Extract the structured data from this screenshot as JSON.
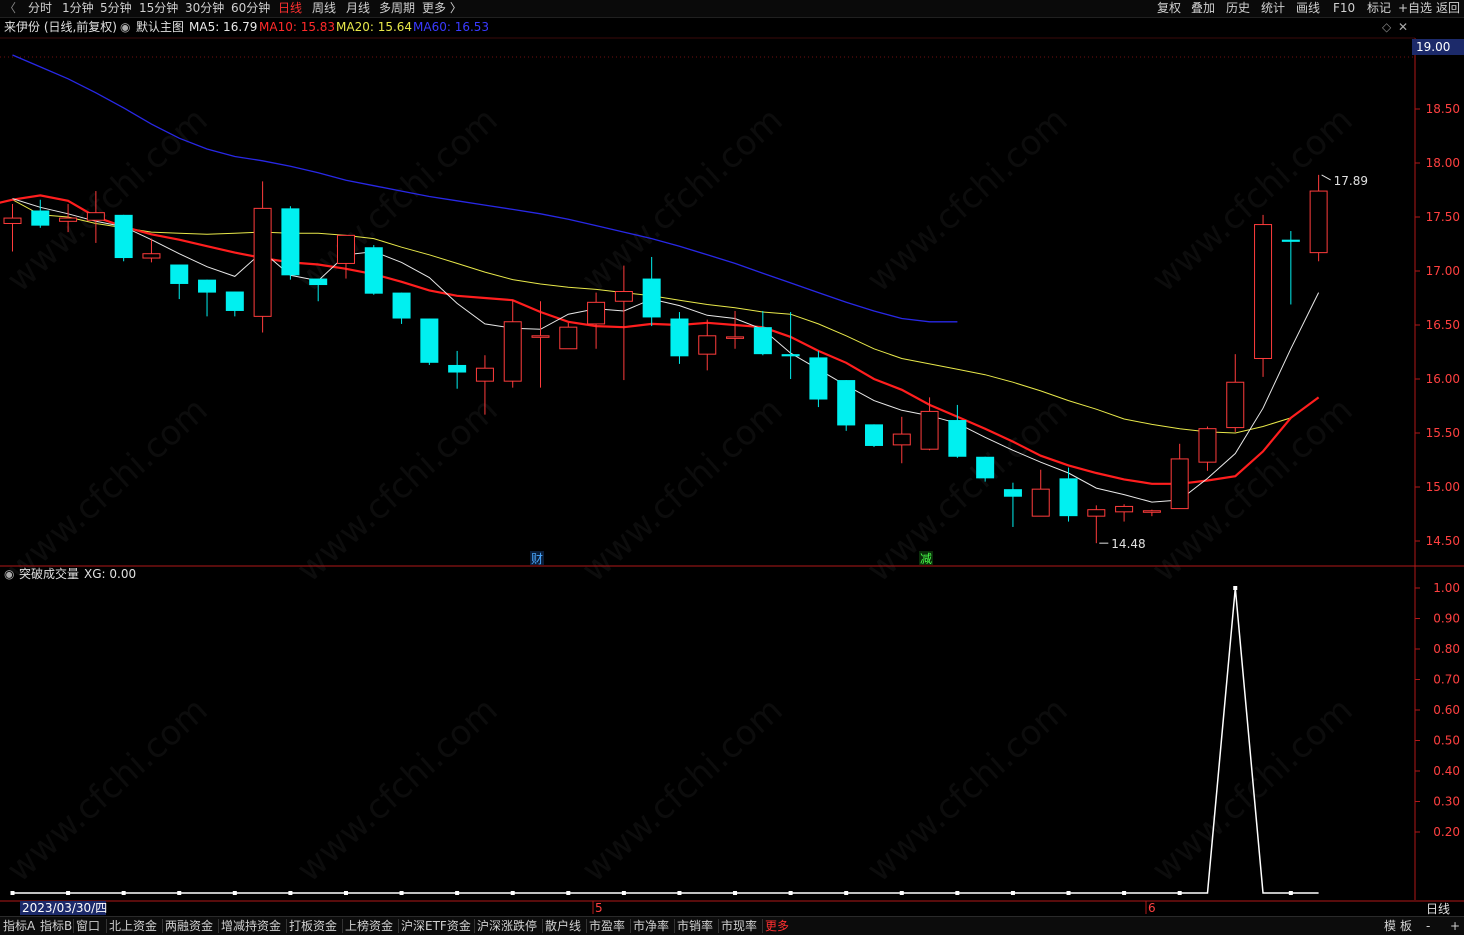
{
  "toolbar": {
    "periods": [
      "分时",
      "1分钟",
      "5分钟",
      "15分钟",
      "30分钟",
      "60分钟",
      "日线",
      "周线",
      "月线",
      "多周期",
      "更多 〉"
    ],
    "active_period": "日线",
    "right_items": [
      "复权",
      "叠加",
      "历史",
      "统计",
      "画线",
      "F10",
      "标记",
      "+自选",
      "返回"
    ]
  },
  "header": {
    "stock": "来伊份 (日线,前复权)",
    "main_chart": "默认主图",
    "ma5": "MA5: 16.79",
    "ma10": "MA10: 15.83",
    "ma20": "MA20: 15.64",
    "ma60": "MA60: 16.53"
  },
  "colors": {
    "up": "#ff3c3c",
    "down": "#00f0f0",
    "ma5": "#e8e8e8",
    "ma10": "#ff1e1e",
    "ma20": "#e8e84a",
    "ma60": "#2828e6",
    "axis": "#b01818",
    "indicator": "#ffffff"
  },
  "price_axis": {
    "current_box": "19.00",
    "ticks": [
      "19.00",
      "18.50",
      "18.00",
      "17.50",
      "17.00",
      "16.50",
      "16.00",
      "15.50",
      "15.00",
      "14.50"
    ]
  },
  "indicator_axis": {
    "ticks": [
      "1.00",
      "0.90",
      "0.80",
      "0.70",
      "0.60",
      "0.50",
      "0.40",
      "0.30",
      "0.20"
    ]
  },
  "indicator": {
    "name": "突破成交量",
    "value": "XG: 0.00"
  },
  "annotations": {
    "high": "17.89",
    "low": "14.48",
    "markers": [
      "财",
      "减"
    ]
  },
  "date_axis": {
    "start_date": "2023/03/30/四",
    "month_labels": [
      "5",
      "6"
    ],
    "corner": "日线"
  },
  "bottom_tabs": [
    "指标A",
    "指标B",
    "窗口",
    "北上资金",
    "两融资金",
    "增减持资金",
    "打板资金",
    "上榜资金",
    "沪深ETF资金",
    "沪深涨跌停",
    "散户线",
    "市盈率",
    "市净率",
    "市销率",
    "市现率",
    "更多"
  ],
  "bottom_right": [
    "模",
    "板",
    "-",
    "+"
  ],
  "watermark": "www.cfchi.com",
  "chart_data": {
    "type": "candlestick",
    "title": "来伊份 (日线,前复权)",
    "ylim": [
      14.3,
      19.1
    ],
    "candles": [
      {
        "o": 17.44,
        "h": 17.62,
        "l": 17.18,
        "c": 17.49
      },
      {
        "o": 17.56,
        "h": 17.66,
        "l": 17.4,
        "c": 17.42
      },
      {
        "o": 17.46,
        "h": 17.62,
        "l": 17.36,
        "c": 17.49
      },
      {
        "o": 17.47,
        "h": 17.74,
        "l": 17.26,
        "c": 17.54
      },
      {
        "o": 17.52,
        "h": 17.52,
        "l": 17.09,
        "c": 17.12
      },
      {
        "o": 17.12,
        "h": 17.3,
        "l": 17.08,
        "c": 17.16
      },
      {
        "o": 17.06,
        "h": 17.06,
        "l": 16.74,
        "c": 16.88
      },
      {
        "o": 16.92,
        "h": 16.92,
        "l": 16.58,
        "c": 16.8
      },
      {
        "o": 16.81,
        "h": 16.81,
        "l": 16.58,
        "c": 16.63
      },
      {
        "o": 16.58,
        "h": 17.83,
        "l": 16.43,
        "c": 17.58
      },
      {
        "o": 17.58,
        "h": 17.6,
        "l": 16.92,
        "c": 16.96
      },
      {
        "o": 16.93,
        "h": 16.93,
        "l": 16.72,
        "c": 16.87
      },
      {
        "o": 17.07,
        "h": 17.33,
        "l": 16.93,
        "c": 17.33
      },
      {
        "o": 17.22,
        "h": 17.24,
        "l": 16.78,
        "c": 16.79
      },
      {
        "o": 16.8,
        "h": 16.8,
        "l": 16.51,
        "c": 16.56
      },
      {
        "o": 16.56,
        "h": 16.56,
        "l": 16.13,
        "c": 16.15
      },
      {
        "o": 16.13,
        "h": 16.26,
        "l": 15.91,
        "c": 16.06
      },
      {
        "o": 15.98,
        "h": 16.22,
        "l": 15.67,
        "c": 16.1
      },
      {
        "o": 15.98,
        "h": 16.73,
        "l": 15.92,
        "c": 16.53
      },
      {
        "o": 16.39,
        "h": 16.72,
        "l": 15.92,
        "c": 16.4
      },
      {
        "o": 16.28,
        "h": 16.52,
        "l": 16.28,
        "c": 16.48
      },
      {
        "o": 16.51,
        "h": 16.8,
        "l": 16.28,
        "c": 16.71
      },
      {
        "o": 16.72,
        "h": 17.05,
        "l": 15.99,
        "c": 16.81
      },
      {
        "o": 16.93,
        "h": 17.13,
        "l": 16.49,
        "c": 16.57
      },
      {
        "o": 16.56,
        "h": 16.62,
        "l": 16.14,
        "c": 16.21
      },
      {
        "o": 16.23,
        "h": 16.55,
        "l": 16.08,
        "c": 16.4
      },
      {
        "o": 16.39,
        "h": 16.63,
        "l": 16.28,
        "c": 16.39
      },
      {
        "o": 16.48,
        "h": 16.63,
        "l": 16.22,
        "c": 16.23
      },
      {
        "o": 16.23,
        "h": 16.62,
        "l": 16.0,
        "c": 16.21
      },
      {
        "o": 16.2,
        "h": 16.26,
        "l": 15.74,
        "c": 15.81
      },
      {
        "o": 15.99,
        "h": 15.99,
        "l": 15.52,
        "c": 15.57
      },
      {
        "o": 15.58,
        "h": 15.58,
        "l": 15.37,
        "c": 15.38
      },
      {
        "o": 15.39,
        "h": 15.65,
        "l": 15.22,
        "c": 15.49
      },
      {
        "o": 15.35,
        "h": 15.83,
        "l": 15.34,
        "c": 15.7
      },
      {
        "o": 15.62,
        "h": 15.76,
        "l": 15.27,
        "c": 15.28
      },
      {
        "o": 15.28,
        "h": 15.28,
        "l": 15.05,
        "c": 15.08
      },
      {
        "o": 14.98,
        "h": 15.04,
        "l": 14.63,
        "c": 14.91
      },
      {
        "o": 14.73,
        "h": 15.16,
        "l": 14.73,
        "c": 14.98
      },
      {
        "o": 15.08,
        "h": 15.18,
        "l": 14.68,
        "c": 14.73
      },
      {
        "o": 14.73,
        "h": 14.83,
        "l": 14.48,
        "c": 14.79
      },
      {
        "o": 14.77,
        "h": 14.84,
        "l": 14.68,
        "c": 14.82
      },
      {
        "o": 14.78,
        "h": 14.79,
        "l": 14.73,
        "c": 14.78
      },
      {
        "o": 14.8,
        "h": 15.4,
        "l": 14.8,
        "c": 15.26
      },
      {
        "o": 15.23,
        "h": 15.56,
        "l": 15.15,
        "c": 15.54
      },
      {
        "o": 15.55,
        "h": 16.23,
        "l": 15.51,
        "c": 15.97
      },
      {
        "o": 16.19,
        "h": 17.52,
        "l": 16.02,
        "c": 17.43
      },
      {
        "o": 17.29,
        "h": 17.37,
        "l": 16.69,
        "c": 17.27
      },
      {
        "o": 17.17,
        "h": 17.89,
        "l": 17.09,
        "c": 17.74
      }
    ],
    "ma5": [
      17.67,
      17.59,
      17.53,
      17.46,
      17.41,
      17.29,
      17.16,
      17.04,
      16.95,
      17.18,
      16.96,
      16.91,
      17.15,
      17.18,
      17.08,
      16.94,
      16.7,
      16.51,
      16.47,
      16.46,
      16.6,
      16.65,
      16.63,
      16.74,
      16.68,
      16.59,
      16.56,
      16.46,
      16.24,
      16.09,
      15.94,
      15.8,
      15.71,
      15.66,
      15.59,
      15.46,
      15.34,
      15.23,
      15.13,
      14.99,
      14.93,
      14.86,
      14.88,
      15.08,
      15.31,
      15.73,
      16.28,
      16.8
    ],
    "ma10": [
      17.55,
      17.6,
      17.66,
      17.7,
      17.65,
      17.5,
      17.41,
      17.34,
      17.29,
      17.23,
      17.17,
      17.12,
      17.08,
      17.06,
      17.02,
      16.97,
      16.9,
      16.82,
      16.77,
      16.75,
      16.73,
      16.62,
      16.53,
      16.49,
      16.48,
      16.51,
      16.5,
      16.52,
      16.5,
      16.48,
      16.39,
      16.26,
      16.15,
      16.0,
      15.9,
      15.76,
      15.65,
      15.54,
      15.42,
      15.29,
      15.2,
      15.13,
      15.07,
      15.03,
      15.03,
      15.06,
      15.1,
      15.33,
      15.64,
      15.83
    ],
    "ma20": [
      17.66,
      17.52,
      17.5,
      17.44,
      17.4,
      17.36,
      17.35,
      17.34,
      17.35,
      17.36,
      17.35,
      17.35,
      17.33,
      17.3,
      17.22,
      17.15,
      17.07,
      16.99,
      16.92,
      16.88,
      16.85,
      16.83,
      16.8,
      16.77,
      16.73,
      16.69,
      16.66,
      16.62,
      16.6,
      16.51,
      16.4,
      16.28,
      16.19,
      16.14,
      16.09,
      16.04,
      15.97,
      15.89,
      15.8,
      15.72,
      15.63,
      15.58,
      15.54,
      15.51,
      15.5,
      15.56,
      15.64
    ],
    "ma60": [
      19.0,
      18.89,
      18.78,
      18.65,
      18.51,
      18.36,
      18.23,
      18.13,
      18.06,
      18.02,
      17.97,
      17.91,
      17.84,
      17.79,
      17.74,
      17.69,
      17.65,
      17.61,
      17.57,
      17.53,
      17.48,
      17.42,
      17.36,
      17.3,
      17.23,
      17.15,
      17.07,
      16.98,
      16.89,
      16.8,
      16.71,
      16.63,
      16.56,
      16.53,
      16.53
    ],
    "indicator_series": {
      "name": "XG",
      "values": [
        0,
        0,
        0,
        0,
        0,
        0,
        0,
        0,
        0,
        0,
        0,
        0,
        0,
        0,
        0,
        0,
        0,
        0,
        0,
        0,
        0,
        0,
        0,
        0,
        0,
        0,
        0,
        0,
        0,
        0,
        0,
        0,
        0,
        0,
        0,
        0,
        0,
        0,
        0,
        0,
        0,
        0,
        0,
        0,
        1,
        0,
        0,
        0
      ]
    }
  }
}
